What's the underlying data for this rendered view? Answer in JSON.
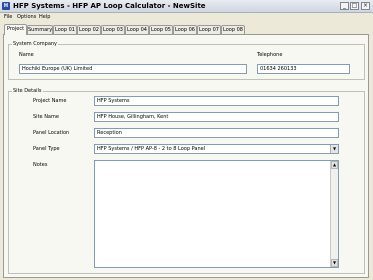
{
  "window": {
    "title": "HFP Systems - HFP AP Loop Calculator - NewSite",
    "buttons": {
      "minimize": "_",
      "maximize": "□",
      "close": "×"
    }
  },
  "menu": {
    "items": [
      "File",
      "Options",
      "Help"
    ]
  },
  "tabs": [
    "Project",
    "Summary",
    "Loop 01",
    "Loop 02",
    "Loop 03",
    "Loop 04",
    "Loop 05",
    "Loop 06",
    "Loop 07",
    "Loop 08"
  ],
  "system_company": {
    "group_label": "System Company",
    "name_label": "Name",
    "name_value": "Hochiki Europe (UK) Limited",
    "telephone_label": "Telephone",
    "telephone_value": "01634 260133"
  },
  "site_details": {
    "group_label": "Site Details",
    "project_name_label": "Project Name",
    "project_name_value": "HFP Systems",
    "site_name_label": "Site Name",
    "site_name_value": "HFP House, Gillingham, Kent",
    "panel_location_label": "Panel Location",
    "panel_location_value": "Reception",
    "panel_type_label": "Panel Type",
    "panel_type_value": "HFP Systems / HFP AP-8 - 2 to 8 Loop Panel",
    "notes_label": "Notes",
    "notes_value": ""
  }
}
